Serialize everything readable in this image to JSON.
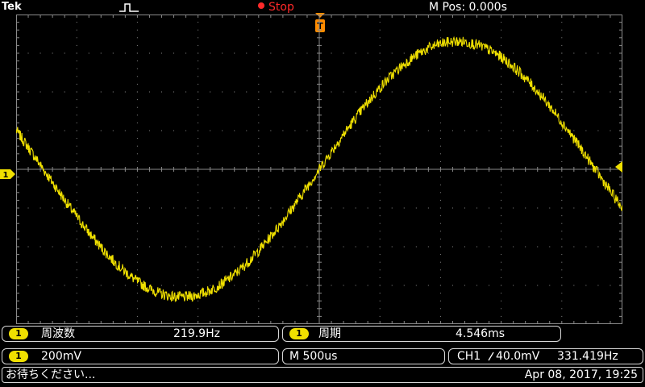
{
  "header": {
    "brand": "Tek",
    "run_state": "Stop",
    "m_pos": "M Pos: 0.000s"
  },
  "colors": {
    "ch1": "#f0e000",
    "stop": "#ff2a2a",
    "trigger": "#ff8c00",
    "grid": "#8a8a8a"
  },
  "channel": {
    "number": "1",
    "marker_label": "1"
  },
  "measurements": [
    {
      "chip": "1",
      "label": "周波数",
      "value": "219.9Hz"
    },
    {
      "chip": "1",
      "label": "周期",
      "value": "4.546ms"
    }
  ],
  "vertical": {
    "chip": "1",
    "scale": "200mV"
  },
  "horizontal": {
    "scale": "M 500us"
  },
  "trigger": {
    "source": "CH1",
    "slope_icon": "rising-edge-icon",
    "level": "40.0mV",
    "freq": "331.419Hz"
  },
  "status": {
    "message": "お待ちください...",
    "timestamp": "Apr 08, 2017, 19:25"
  },
  "chart_data": {
    "type": "line",
    "series": [
      {
        "amplitude_divs": 3.3,
        "offset_divs": 0.0,
        "period_divs": 9.1,
        "phase_zero_at_x_div": 5.0,
        "noise": true
      }
    ],
    "x_divisions": 10,
    "y_divisions": 8,
    "grid": true
  }
}
